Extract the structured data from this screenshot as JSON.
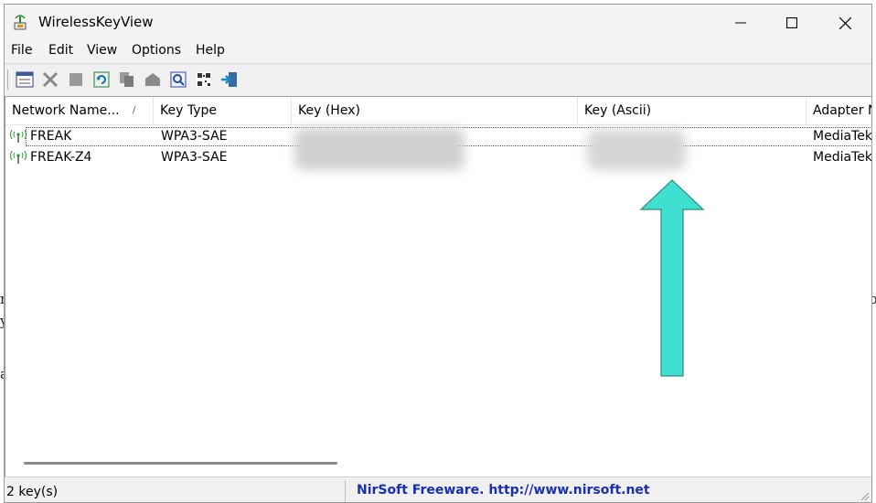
{
  "window": {
    "title": "WirelessKeyView"
  },
  "menu": [
    "File",
    "Edit",
    "View",
    "Options",
    "Help"
  ],
  "toolbar": [
    "properties-icon",
    "delete-icon",
    "stop-icon",
    "refresh-icon",
    "copy-icon",
    "export-icon",
    "find-icon",
    "qr-code-icon",
    "exit-icon"
  ],
  "columns": [
    "Network Name...",
    "Key Type",
    "Key (Hex)",
    "Key (Ascii)",
    "Adapter N"
  ],
  "sort_indicator": "/",
  "rows": [
    {
      "name": "FREAK",
      "key_type": "WPA3-SAE",
      "adapter": "MediaTek_"
    },
    {
      "name": "FREAK-Z4",
      "key_type": "WPA3-SAE",
      "adapter": "MediaTek"
    }
  ],
  "status": {
    "count": "2 key(s)",
    "credit": "NirSoft Freeware.  http://www.nirsoft.net"
  },
  "colors": {
    "arrow": "#40e0d0",
    "credit": "#1a2fb0"
  }
}
